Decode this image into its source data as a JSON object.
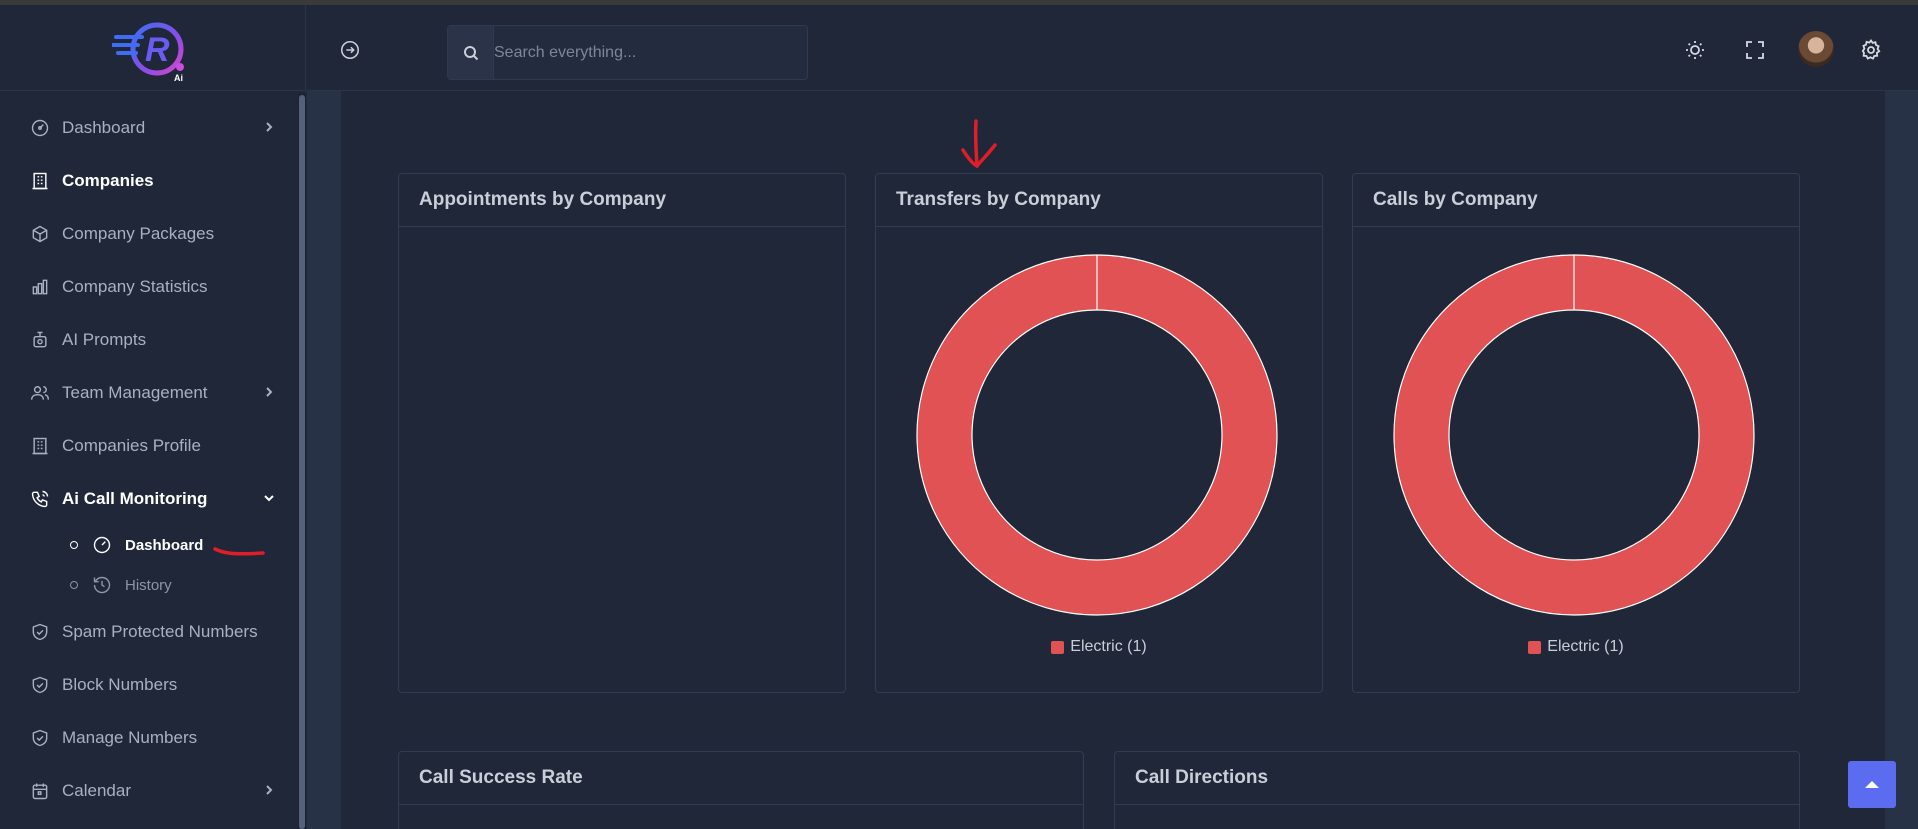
{
  "brand": {
    "logo_letter": "R",
    "logo_sub": "Ai"
  },
  "header": {
    "search_placeholder": "Search everything..."
  },
  "sidebar": {
    "items": [
      {
        "label": "Dashboard",
        "icon": "gauge-icon",
        "chevron": true,
        "active": false
      },
      {
        "label": "Companies",
        "icon": "building-icon",
        "chevron": false,
        "active": true
      },
      {
        "label": "Company Packages",
        "icon": "package-icon",
        "chevron": false,
        "active": false
      },
      {
        "label": "Company Statistics",
        "icon": "bar-chart-icon",
        "chevron": false,
        "active": false
      },
      {
        "label": "AI Prompts",
        "icon": "robot-icon",
        "chevron": false,
        "active": false
      },
      {
        "label": "Team Management",
        "icon": "users-icon",
        "chevron": true,
        "active": false
      },
      {
        "label": "Companies Profile",
        "icon": "building-icon",
        "chevron": false,
        "active": false
      },
      {
        "label": "Ai Call Monitoring",
        "icon": "phone-call-icon",
        "chevron": true,
        "active": true,
        "expanded": true
      },
      {
        "label": "Spam Protected Numbers",
        "icon": "shield-check-icon",
        "chevron": false,
        "active": false
      },
      {
        "label": "Block Numbers",
        "icon": "shield-check-icon",
        "chevron": false,
        "active": false
      },
      {
        "label": "Manage Numbers",
        "icon": "shield-check-icon",
        "chevron": false,
        "active": false
      },
      {
        "label": "Calendar",
        "icon": "calendar-icon",
        "chevron": true,
        "active": false
      }
    ],
    "sub_items": [
      {
        "label": "Dashboard",
        "icon": "gauge-icon",
        "active": true
      },
      {
        "label": "History",
        "icon": "history-icon",
        "active": false
      }
    ]
  },
  "cards": {
    "appointments": {
      "title": "Appointments by Company"
    },
    "transfers": {
      "title": "Transfers by Company",
      "legend": "Electric (1)"
    },
    "calls": {
      "title": "Calls by Company",
      "legend": "Electric (1)"
    },
    "success_rate": {
      "title": "Call Success Rate"
    },
    "directions": {
      "title": "Call Directions"
    }
  },
  "chart_data": [
    {
      "type": "pie",
      "title": "Appointments by Company",
      "categories": [],
      "values": []
    },
    {
      "type": "pie",
      "title": "Transfers by Company",
      "categories": [
        "Electric"
      ],
      "values": [
        1
      ],
      "colors": [
        "#e05254"
      ],
      "donut": true
    },
    {
      "type": "pie",
      "title": "Calls by Company",
      "categories": [
        "Electric"
      ],
      "values": [
        1
      ],
      "colors": [
        "#e05254"
      ],
      "donut": true
    }
  ],
  "colors": {
    "accent": "#5b6cf0",
    "series": "#e05254",
    "background": "#1f2739"
  }
}
